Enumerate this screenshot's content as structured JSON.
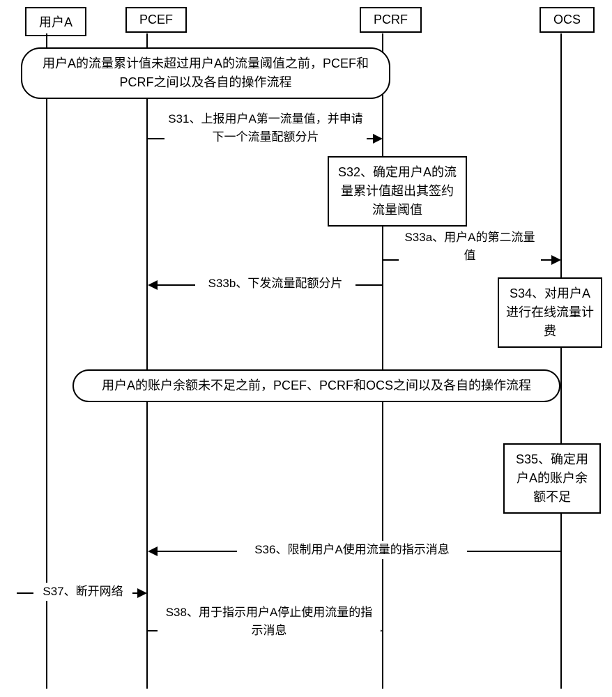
{
  "participants": {
    "userA": "用户A",
    "pcef": "PCEF",
    "pcrf": "PCRF",
    "ocs": "OCS"
  },
  "notes": {
    "note1": "用户A的流量累计值未超过用户A的流量阈值之前，PCEF和PCRF之间以及各自的操作流程",
    "note2": "用户A的账户余额未不足之前，PCEF、PCRF和OCS之间以及各自的操作流程"
  },
  "messages": {
    "s31": "S31、上报用户A第一流量值，并申请下一个流量配额分片",
    "s32": "S32、确定用户A的流量累计值超出其签约流量阈值",
    "s33a": "S33a、用户A的第二流量值",
    "s33b": "S33b、下发流量配额分片",
    "s34": "S34、对用户A进行在线流量计费",
    "s35": "S35、确定用户A的账户余额不足",
    "s36": "S36、限制用户A使用流量的指示消息",
    "s37": "S37、断开网络",
    "s38": "S38、用于指示用户A停止使用流量的指示消息"
  }
}
